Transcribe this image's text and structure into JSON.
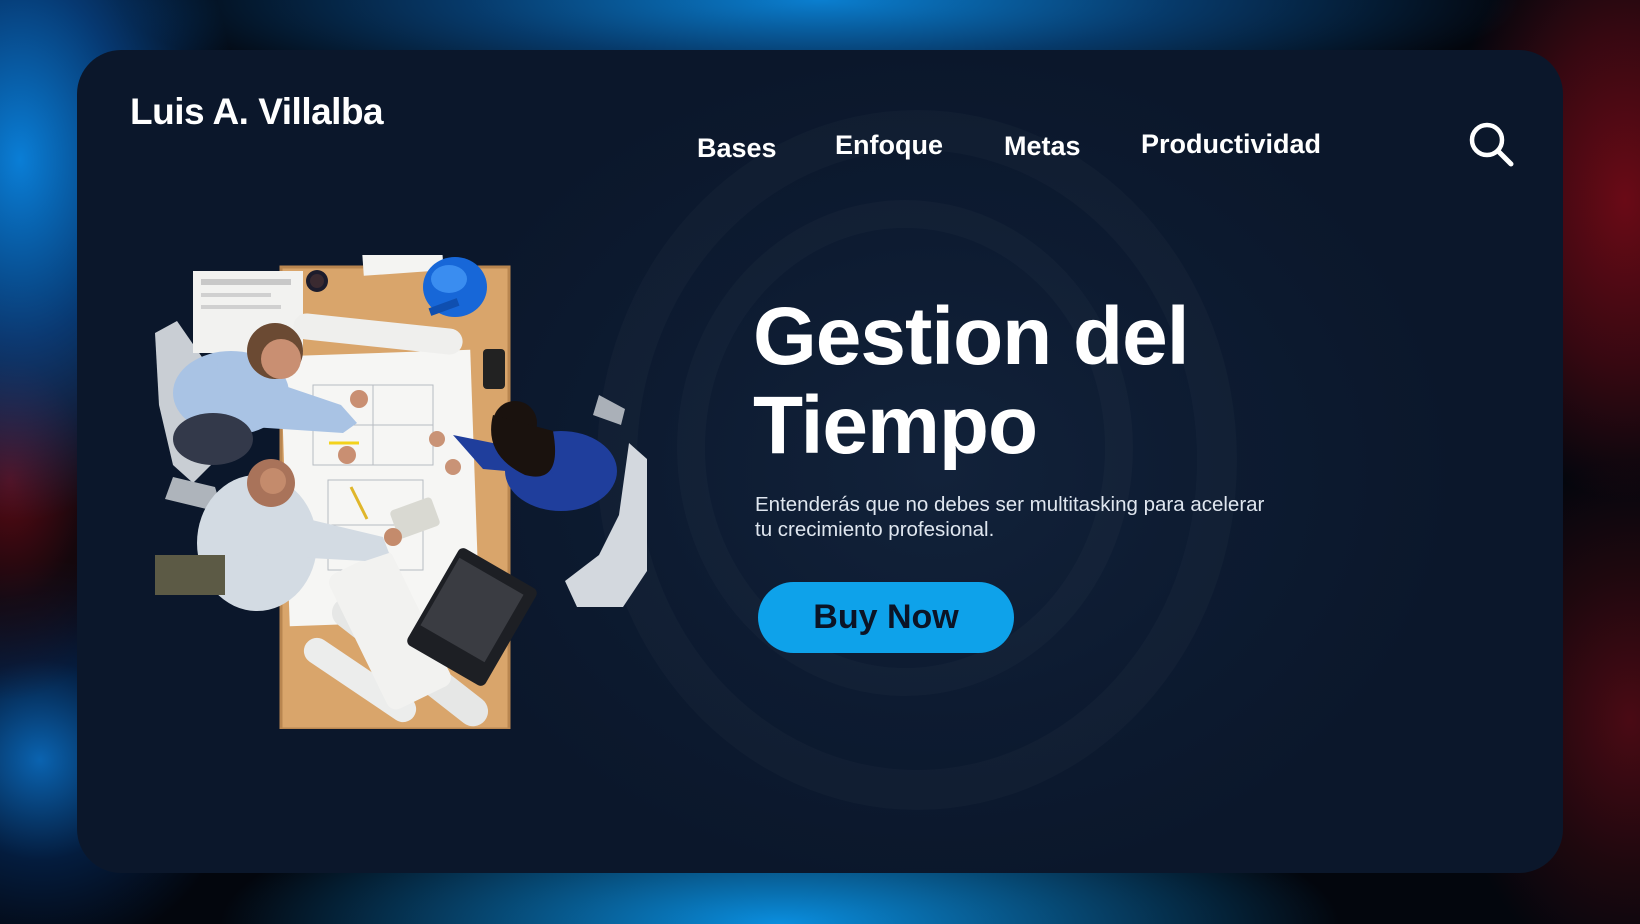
{
  "brand": {
    "name": "Luis A. Villalba"
  },
  "nav": {
    "items": [
      {
        "label": "Bases"
      },
      {
        "label": "Enfoque"
      },
      {
        "label": "Metas"
      },
      {
        "label": "Productividad"
      }
    ],
    "search_icon": "search-icon"
  },
  "hero": {
    "title_line1": "Gestion del",
    "title_line2": "Tiempo",
    "subtitle": "Entenderás que no debes ser multitasking para acelerar tu crecimiento profesional.",
    "cta_label": "Buy Now",
    "image": "team-meeting-top-view-photo"
  },
  "colors": {
    "card": "#0d1b31",
    "accent": "#0ea2ea",
    "text": "#ffffff",
    "button_text": "#0b1426"
  }
}
